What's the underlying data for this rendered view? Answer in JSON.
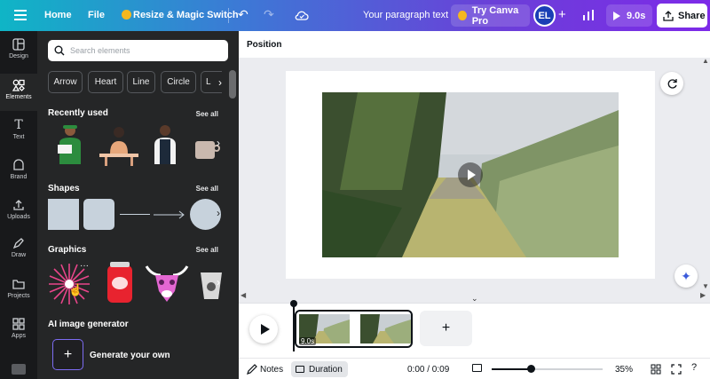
{
  "topbar": {
    "home": "Home",
    "file": "File",
    "resize": "Resize & Magic Switch",
    "doc_title": "Your paragraph text",
    "try_pro": "Try Canva Pro",
    "avatar": "EL",
    "duration": "9.0s",
    "share": "Share"
  },
  "rail": {
    "items": [
      {
        "label": "Design",
        "icon": "design-icon"
      },
      {
        "label": "Elements",
        "icon": "elements-icon"
      },
      {
        "label": "Text",
        "icon": "text-icon"
      },
      {
        "label": "Brand",
        "icon": "brand-icon"
      },
      {
        "label": "Uploads",
        "icon": "uploads-icon"
      },
      {
        "label": "Draw",
        "icon": "draw-icon"
      },
      {
        "label": "Projects",
        "icon": "projects-icon"
      },
      {
        "label": "Apps",
        "icon": "apps-icon"
      }
    ]
  },
  "panel": {
    "search_placeholder": "Search elements",
    "chips": [
      "Arrow",
      "Heart",
      "Line",
      "Circle",
      "Lo"
    ],
    "recently_used": "Recently used",
    "shapes": "Shapes",
    "graphics": "Graphics",
    "see_all": "See all",
    "ai_generator": "AI image generator",
    "generate": "Generate your own"
  },
  "editor": {
    "position": "Position"
  },
  "timeline": {
    "clip_duration": "9.0s"
  },
  "bottombar": {
    "notes": "Notes",
    "duration": "Duration",
    "time": "0:00 / 0:09",
    "zoom": "35%",
    "zoom_fraction": 0.35
  },
  "colors": {
    "accent": "#7d2ae8",
    "panel_bg": "#252627",
    "rail_bg": "#18191b",
    "avatar_bg": "#1a3fb5"
  }
}
